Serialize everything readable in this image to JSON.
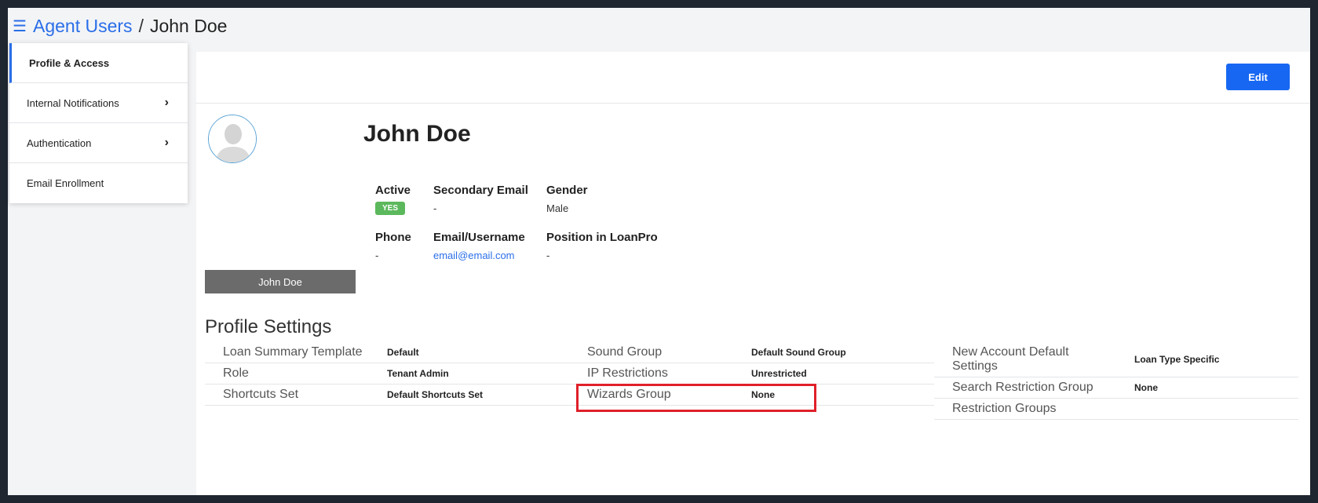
{
  "header": {
    "menu_icon": "hamburger-icon",
    "breadcrumb_parent": "Agent Users",
    "breadcrumb_sep": "/",
    "breadcrumb_current": "John Doe"
  },
  "sidebar": {
    "items": [
      {
        "label": "Profile & Access",
        "active": true
      },
      {
        "label": "Internal Notifications",
        "chevron": true
      },
      {
        "label": "Authentication",
        "chevron": true
      },
      {
        "label": "Email Enrollment"
      }
    ]
  },
  "toolbar": {
    "edit_label": "Edit"
  },
  "profile": {
    "name": "John Doe",
    "avatar_caption": "John Doe",
    "fields": {
      "active_label": "Active",
      "active_value": "YES",
      "secondary_email_label": "Secondary Email",
      "secondary_email_value": "-",
      "gender_label": "Gender",
      "gender_value": "Male",
      "phone_label": "Phone",
      "phone_value": "-",
      "email_label": "Email/Username",
      "email_value": "email@email.com",
      "position_label": "Position in LoanPro",
      "position_value": "-"
    }
  },
  "settings": {
    "title": "Profile Settings",
    "col1": [
      {
        "key": "Loan Summary Template",
        "value": "Default"
      },
      {
        "key": "Role",
        "value": "Tenant Admin"
      },
      {
        "key": "Shortcuts Set",
        "value": "Default Shortcuts Set"
      }
    ],
    "col2": [
      {
        "key": "Sound Group",
        "value": "Default Sound Group"
      },
      {
        "key": "IP Restrictions",
        "value": "Unrestricted"
      },
      {
        "key": "Wizards Group",
        "value": "None"
      }
    ],
    "col3": [
      {
        "key": "New Account Default Settings",
        "value": "Loan Type Specific"
      },
      {
        "key": "Search Restriction Group",
        "value": "None"
      },
      {
        "key": "Restriction Groups",
        "value": ""
      }
    ]
  },
  "colors": {
    "accent": "#2a6ee8",
    "edit_button": "#1767f2",
    "badge_green": "#5cb85c",
    "highlight_red": "#e0202a"
  }
}
